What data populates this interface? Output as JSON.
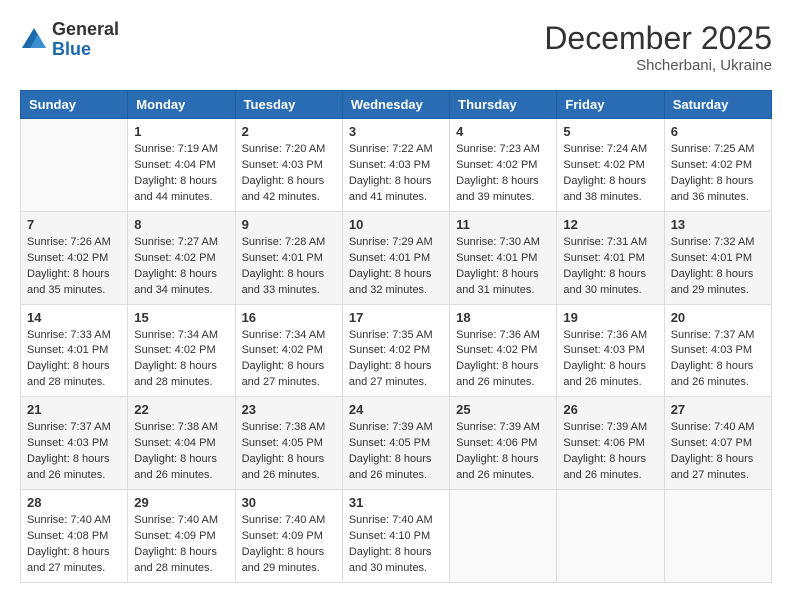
{
  "logo": {
    "general": "General",
    "blue": "Blue"
  },
  "header": {
    "month": "December 2025",
    "location": "Shcherbani, Ukraine"
  },
  "weekdays": [
    "Sunday",
    "Monday",
    "Tuesday",
    "Wednesday",
    "Thursday",
    "Friday",
    "Saturday"
  ],
  "weeks": [
    [
      {
        "day": "",
        "sunrise": "",
        "sunset": "",
        "daylight": ""
      },
      {
        "day": "1",
        "sunrise": "Sunrise: 7:19 AM",
        "sunset": "Sunset: 4:04 PM",
        "daylight": "Daylight: 8 hours and 44 minutes."
      },
      {
        "day": "2",
        "sunrise": "Sunrise: 7:20 AM",
        "sunset": "Sunset: 4:03 PM",
        "daylight": "Daylight: 8 hours and 42 minutes."
      },
      {
        "day": "3",
        "sunrise": "Sunrise: 7:22 AM",
        "sunset": "Sunset: 4:03 PM",
        "daylight": "Daylight: 8 hours and 41 minutes."
      },
      {
        "day": "4",
        "sunrise": "Sunrise: 7:23 AM",
        "sunset": "Sunset: 4:02 PM",
        "daylight": "Daylight: 8 hours and 39 minutes."
      },
      {
        "day": "5",
        "sunrise": "Sunrise: 7:24 AM",
        "sunset": "Sunset: 4:02 PM",
        "daylight": "Daylight: 8 hours and 38 minutes."
      },
      {
        "day": "6",
        "sunrise": "Sunrise: 7:25 AM",
        "sunset": "Sunset: 4:02 PM",
        "daylight": "Daylight: 8 hours and 36 minutes."
      }
    ],
    [
      {
        "day": "7",
        "sunrise": "Sunrise: 7:26 AM",
        "sunset": "Sunset: 4:02 PM",
        "daylight": "Daylight: 8 hours and 35 minutes."
      },
      {
        "day": "8",
        "sunrise": "Sunrise: 7:27 AM",
        "sunset": "Sunset: 4:02 PM",
        "daylight": "Daylight: 8 hours and 34 minutes."
      },
      {
        "day": "9",
        "sunrise": "Sunrise: 7:28 AM",
        "sunset": "Sunset: 4:01 PM",
        "daylight": "Daylight: 8 hours and 33 minutes."
      },
      {
        "day": "10",
        "sunrise": "Sunrise: 7:29 AM",
        "sunset": "Sunset: 4:01 PM",
        "daylight": "Daylight: 8 hours and 32 minutes."
      },
      {
        "day": "11",
        "sunrise": "Sunrise: 7:30 AM",
        "sunset": "Sunset: 4:01 PM",
        "daylight": "Daylight: 8 hours and 31 minutes."
      },
      {
        "day": "12",
        "sunrise": "Sunrise: 7:31 AM",
        "sunset": "Sunset: 4:01 PM",
        "daylight": "Daylight: 8 hours and 30 minutes."
      },
      {
        "day": "13",
        "sunrise": "Sunrise: 7:32 AM",
        "sunset": "Sunset: 4:01 PM",
        "daylight": "Daylight: 8 hours and 29 minutes."
      }
    ],
    [
      {
        "day": "14",
        "sunrise": "Sunrise: 7:33 AM",
        "sunset": "Sunset: 4:01 PM",
        "daylight": "Daylight: 8 hours and 28 minutes."
      },
      {
        "day": "15",
        "sunrise": "Sunrise: 7:34 AM",
        "sunset": "Sunset: 4:02 PM",
        "daylight": "Daylight: 8 hours and 28 minutes."
      },
      {
        "day": "16",
        "sunrise": "Sunrise: 7:34 AM",
        "sunset": "Sunset: 4:02 PM",
        "daylight": "Daylight: 8 hours and 27 minutes."
      },
      {
        "day": "17",
        "sunrise": "Sunrise: 7:35 AM",
        "sunset": "Sunset: 4:02 PM",
        "daylight": "Daylight: 8 hours and 27 minutes."
      },
      {
        "day": "18",
        "sunrise": "Sunrise: 7:36 AM",
        "sunset": "Sunset: 4:02 PM",
        "daylight": "Daylight: 8 hours and 26 minutes."
      },
      {
        "day": "19",
        "sunrise": "Sunrise: 7:36 AM",
        "sunset": "Sunset: 4:03 PM",
        "daylight": "Daylight: 8 hours and 26 minutes."
      },
      {
        "day": "20",
        "sunrise": "Sunrise: 7:37 AM",
        "sunset": "Sunset: 4:03 PM",
        "daylight": "Daylight: 8 hours and 26 minutes."
      }
    ],
    [
      {
        "day": "21",
        "sunrise": "Sunrise: 7:37 AM",
        "sunset": "Sunset: 4:03 PM",
        "daylight": "Daylight: 8 hours and 26 minutes."
      },
      {
        "day": "22",
        "sunrise": "Sunrise: 7:38 AM",
        "sunset": "Sunset: 4:04 PM",
        "daylight": "Daylight: 8 hours and 26 minutes."
      },
      {
        "day": "23",
        "sunrise": "Sunrise: 7:38 AM",
        "sunset": "Sunset: 4:05 PM",
        "daylight": "Daylight: 8 hours and 26 minutes."
      },
      {
        "day": "24",
        "sunrise": "Sunrise: 7:39 AM",
        "sunset": "Sunset: 4:05 PM",
        "daylight": "Daylight: 8 hours and 26 minutes."
      },
      {
        "day": "25",
        "sunrise": "Sunrise: 7:39 AM",
        "sunset": "Sunset: 4:06 PM",
        "daylight": "Daylight: 8 hours and 26 minutes."
      },
      {
        "day": "26",
        "sunrise": "Sunrise: 7:39 AM",
        "sunset": "Sunset: 4:06 PM",
        "daylight": "Daylight: 8 hours and 26 minutes."
      },
      {
        "day": "27",
        "sunrise": "Sunrise: 7:40 AM",
        "sunset": "Sunset: 4:07 PM",
        "daylight": "Daylight: 8 hours and 27 minutes."
      }
    ],
    [
      {
        "day": "28",
        "sunrise": "Sunrise: 7:40 AM",
        "sunset": "Sunset: 4:08 PM",
        "daylight": "Daylight: 8 hours and 27 minutes."
      },
      {
        "day": "29",
        "sunrise": "Sunrise: 7:40 AM",
        "sunset": "Sunset: 4:09 PM",
        "daylight": "Daylight: 8 hours and 28 minutes."
      },
      {
        "day": "30",
        "sunrise": "Sunrise: 7:40 AM",
        "sunset": "Sunset: 4:09 PM",
        "daylight": "Daylight: 8 hours and 29 minutes."
      },
      {
        "day": "31",
        "sunrise": "Sunrise: 7:40 AM",
        "sunset": "Sunset: 4:10 PM",
        "daylight": "Daylight: 8 hours and 30 minutes."
      },
      {
        "day": "",
        "sunrise": "",
        "sunset": "",
        "daylight": ""
      },
      {
        "day": "",
        "sunrise": "",
        "sunset": "",
        "daylight": ""
      },
      {
        "day": "",
        "sunrise": "",
        "sunset": "",
        "daylight": ""
      }
    ]
  ]
}
